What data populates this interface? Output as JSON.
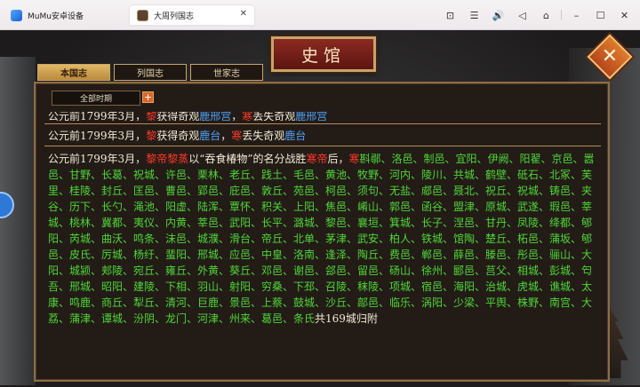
{
  "emulator": {
    "tabs": [
      "MuMu安卓设备",
      "大周列国志"
    ],
    "close_glyph": "✕",
    "controls": [
      "⊡",
      "☰",
      "🔊",
      "◁",
      "⌂",
      "–",
      "☐",
      "✕"
    ]
  },
  "header": {
    "title": "史馆"
  },
  "tabs": [
    "本国志",
    "列国志",
    "世家志"
  ],
  "filter": {
    "label": "全部时期",
    "plus": "+"
  },
  "records": {
    "line1": [
      {
        "t": "公元前1799年3月，",
        "c": "w"
      },
      {
        "t": "黎",
        "c": "r"
      },
      {
        "t": "获得奇观",
        "c": "w"
      },
      {
        "t": "鹿邢宫",
        "c": "b"
      },
      {
        "t": "，",
        "c": "w"
      },
      {
        "t": "寒",
        "c": "r"
      },
      {
        "t": "丢失奇观",
        "c": "w"
      },
      {
        "t": "鹿邢宫",
        "c": "b"
      }
    ],
    "line2": [
      {
        "t": "公元前1799年3月，",
        "c": "w"
      },
      {
        "t": "黎",
        "c": "r"
      },
      {
        "t": "获得奇观",
        "c": "w"
      },
      {
        "t": "鹿台",
        "c": "b"
      },
      {
        "t": "，",
        "c": "w"
      },
      {
        "t": "寒",
        "c": "r"
      },
      {
        "t": "丢失奇观",
        "c": "w"
      },
      {
        "t": "鹿台",
        "c": "b"
      }
    ],
    "main": [
      {
        "t": "公元前1799年3月，",
        "c": "w"
      },
      {
        "t": "黎帝黎蒸",
        "c": "r"
      },
      {
        "t": "以“吞食椿物”的名分战胜",
        "c": "w"
      },
      {
        "t": "寒帝",
        "c": "r"
      },
      {
        "t": "后，",
        "c": "w"
      },
      {
        "t": "寒",
        "c": "r"
      },
      {
        "t": "斟鄩、洛邑、制邑、宜阳、伊阙、阳翟、京邑、嚣邑、甘野、长葛、祝城、许邑、栗林、老丘、践土、毛邑、黄池、牧野、河内、陵川、共城、鹤壁、砥石、北冢、芙里、桂陵、封丘、匡邑、曹邑、郢邑、庇邑、敦丘、苑邑、柯邑、须句、无盐、郕邑、聂北、祝丘、祝城、铸邑、夹谷、历下、长勺、渑池、阳虚、陆浑、覃怀、积关、上阳、焦邑、崤山、郭邑、函谷、盟津、原城、武遂、瑕邑、莘城、桃林、冀都、夷仪、内黄、莘邑、武阳、长平、潞城、黎邑、襄垣、箕城、长子、涅邑、甘丹、凤陵、绛都、郇阳、芮城、曲沃、鸣条、沫邑、城濮、滑台、帝丘、北单、茅津、武安、柏人、铁城、馆陶、楚丘、柘邑、蒲坂、郇邑、皮氏、厉城、杨纡、蜚阳、邢城、应邑、中皇、洛南、逢泽、陶丘、费邑、郸邑、薛邑、滕邑、彤邑、骊山、大阳、城颍、郏陵、宛丘、雍丘、外黄、葵丘、邓邑、谢邑、郐邑、留邑、砀山、徐州、郾邑、莒父、相城、彭城、匄吾、邢城、昭阳、建陵、下相、羽山、射阳、穷桑、下邳、召陵、秣陵、项城、宿邑、海阳、治城、虎城、谯城、太康、鸣鹿、商丘、犁丘、清河、巨鹿、景邑、上蔡、鼓城、沙丘、鄗邑、临乐、涡阳、少梁、平舆、株野、南宫、大荔、蒲津、谭城、汾阴、龙门、河津、州来、葛邑、条氏",
        "c": "g"
      },
      {
        "t": "共169城归附",
        "c": "w"
      }
    ]
  }
}
